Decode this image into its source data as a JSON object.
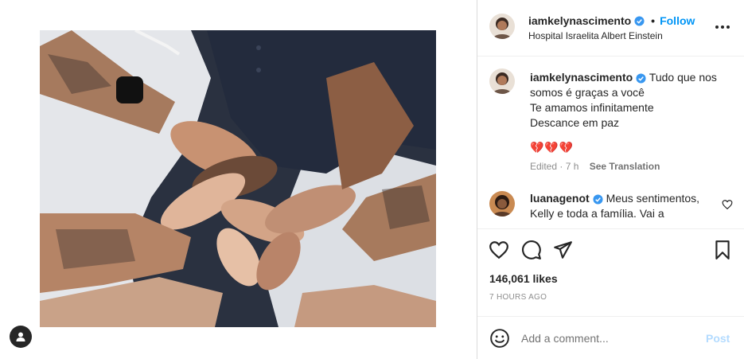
{
  "post": {
    "username": "iamkelynascimento",
    "location": "Hospital Israelita Albert Einstein",
    "follow_label": "Follow",
    "dot": "•"
  },
  "caption": {
    "username": "iamkelynascimento",
    "line1": "Tudo que nos somos é graças a você",
    "line2": "Te amamos infinitamente",
    "line3": "Descance em paz",
    "hearts": "💔💔💔",
    "edited": "Edited · 7 h",
    "see_translation": "See Translation"
  },
  "comment": {
    "username": "luanagenot",
    "text": "Meus sentimentos, Kelly e toda a família. Vai a"
  },
  "stats": {
    "likes": "146,061 likes",
    "time": "7 HOURS AGO"
  },
  "composer": {
    "placeholder": "Add a comment...",
    "post_label": "Post"
  },
  "colors": {
    "accent": "#0095f6",
    "verified": "#3897f0",
    "post_disabled": "#b3dbff"
  },
  "icons": [
    "user-tag-icon",
    "verified-icon",
    "more-options-icon",
    "heart-icon",
    "comment-icon",
    "share-icon",
    "bookmark-icon",
    "emoji-icon"
  ]
}
